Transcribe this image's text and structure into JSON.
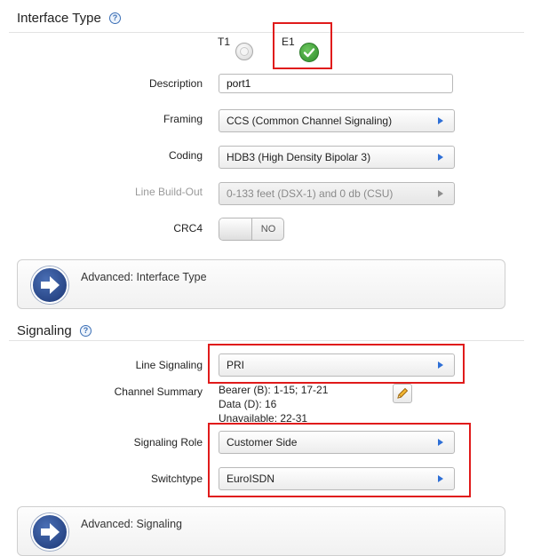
{
  "interface_type": {
    "title": "Interface Type",
    "options": [
      {
        "label": "T1",
        "selected": false
      },
      {
        "label": "E1",
        "selected": true
      }
    ],
    "fields": {
      "description": {
        "label": "Description",
        "value": "port1"
      },
      "framing": {
        "label": "Framing",
        "value": "CCS (Common Channel Signaling)"
      },
      "coding": {
        "label": "Coding",
        "value": "HDB3 (High Density Bipolar 3)"
      },
      "line_build_out": {
        "label": "Line Build-Out",
        "value": "0-133 feet (DSX-1) and 0 db (CSU)",
        "disabled": true
      },
      "crc4": {
        "label": "CRC4",
        "value": "NO"
      }
    },
    "advanced_label": "Advanced: Interface Type"
  },
  "signaling": {
    "title": "Signaling",
    "line_signaling": {
      "label": "Line Signaling",
      "value": "PRI"
    },
    "channel_summary": {
      "label": "Channel Summary",
      "lines": [
        "Bearer (B): 1-15; 17-21",
        "Data (D): 16",
        "Unavailable: 22-31"
      ]
    },
    "signaling_role": {
      "label": "Signaling Role",
      "value": "Customer Side"
    },
    "switchtype": {
      "label": "Switchtype",
      "value": "EuroISDN"
    },
    "advanced_label": "Advanced: Signaling"
  },
  "colors": {
    "highlight": "#e01b1b",
    "accent": "#2e6fd6",
    "check": "#3aa635"
  },
  "icons": [
    "help-icon",
    "radio-icon",
    "check-icon",
    "arrow-right-icon",
    "pencil-icon"
  ]
}
